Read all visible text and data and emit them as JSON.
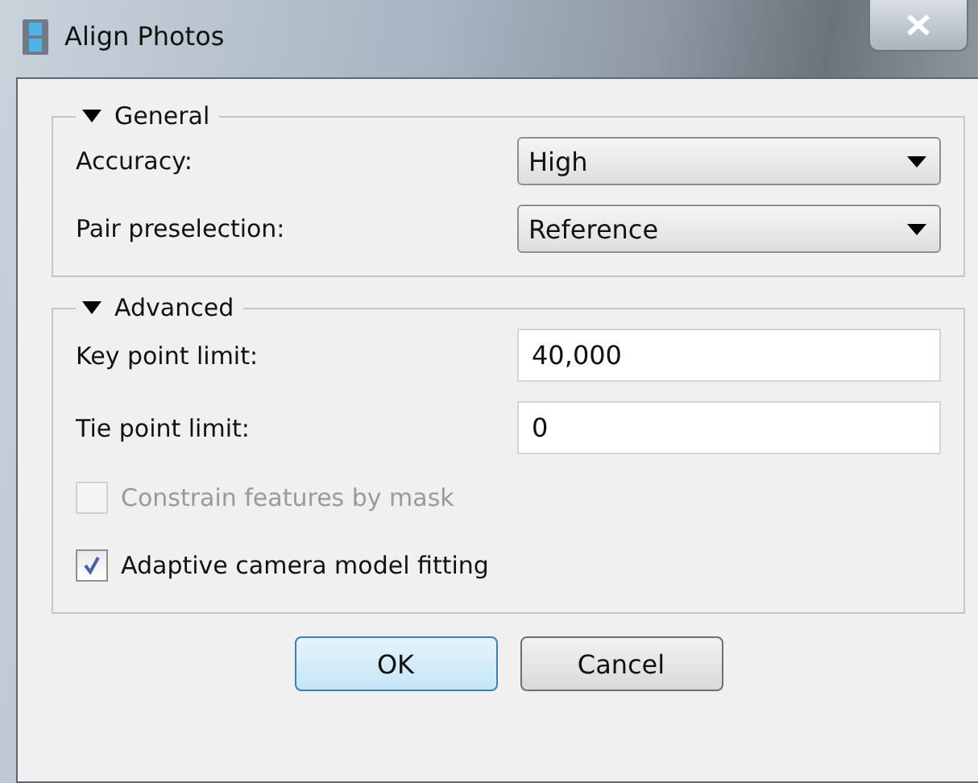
{
  "window": {
    "title": "Align Photos"
  },
  "groups": [
    {
      "title": "General",
      "expanded": true,
      "rows": [
        {
          "kind": "dropdown",
          "label": "Accuracy:",
          "value": "High"
        },
        {
          "kind": "dropdown",
          "label": "Pair preselection:",
          "value": "Reference"
        }
      ]
    },
    {
      "title": "Advanced",
      "expanded": true,
      "rows": [
        {
          "kind": "field",
          "label": "Key point limit:",
          "value": "40,000"
        },
        {
          "kind": "field",
          "label": "Tie point limit:",
          "value": "0"
        },
        {
          "kind": "checkbox",
          "label": "Constrain features by mask",
          "checked": false,
          "disabled": true
        },
        {
          "kind": "checkbox",
          "label": "Adaptive camera model fitting",
          "checked": true,
          "disabled": false
        }
      ]
    }
  ],
  "buttons": [
    {
      "label": "OK",
      "default": true
    },
    {
      "label": "Cancel",
      "default": false
    }
  ]
}
